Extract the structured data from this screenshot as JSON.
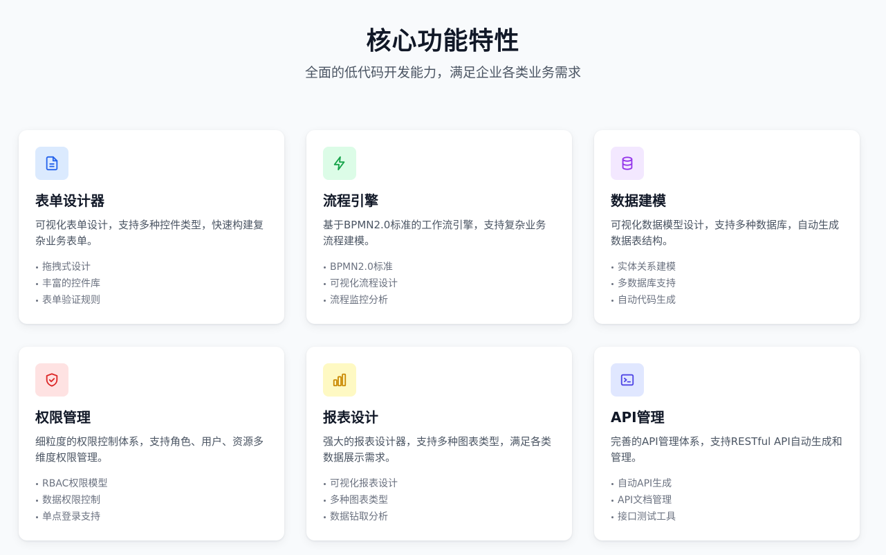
{
  "hero": {
    "title": "核心功能特性",
    "subtitle": "全面的低代码开发能力，满足企业各类业务需求"
  },
  "cards": [
    {
      "title": "表单设计器",
      "desc": "可视化表单设计，支持多种控件类型，快速构建复杂业务表单。",
      "features": [
        "拖拽式设计",
        "丰富的控件库",
        "表单验证规则"
      ],
      "icon": "document-icon",
      "icon_bg": "#dbeafe",
      "icon_color": "#2563eb"
    },
    {
      "title": "流程引擎",
      "desc": "基于BPMN2.0标准的工作流引擎，支持复杂业务流程建模。",
      "features": [
        "BPMN2.0标准",
        "可视化流程设计",
        "流程监控分析"
      ],
      "icon": "lightning-icon",
      "icon_bg": "#dcfce7",
      "icon_color": "#16a34a"
    },
    {
      "title": "数据建模",
      "desc": "可视化数据模型设计，支持多种数据库，自动生成数据表结构。",
      "features": [
        "实体关系建模",
        "多数据库支持",
        "自动代码生成"
      ],
      "icon": "database-icon",
      "icon_bg": "#f3e8ff",
      "icon_color": "#9333ea"
    },
    {
      "title": "权限管理",
      "desc": "细粒度的权限控制体系，支持角色、用户、资源多维度权限管理。",
      "features": [
        "RBAC权限模型",
        "数据权限控制",
        "单点登录支持"
      ],
      "icon": "shield-check-icon",
      "icon_bg": "#fee2e2",
      "icon_color": "#dc2626"
    },
    {
      "title": "报表设计",
      "desc": "强大的报表设计器，支持多种图表类型，满足各类数据展示需求。",
      "features": [
        "可视化报表设计",
        "多种图表类型",
        "数据钻取分析"
      ],
      "icon": "bar-chart-icon",
      "icon_bg": "#fef9c3",
      "icon_color": "#ca8a04"
    },
    {
      "title": "API管理",
      "desc": "完善的API管理体系，支持RESTful API自动生成和管理。",
      "features": [
        "自动API生成",
        "API文档管理",
        "接口测试工具"
      ],
      "icon": "terminal-icon",
      "icon_bg": "#e0e7ff",
      "icon_color": "#4f46e5"
    }
  ]
}
